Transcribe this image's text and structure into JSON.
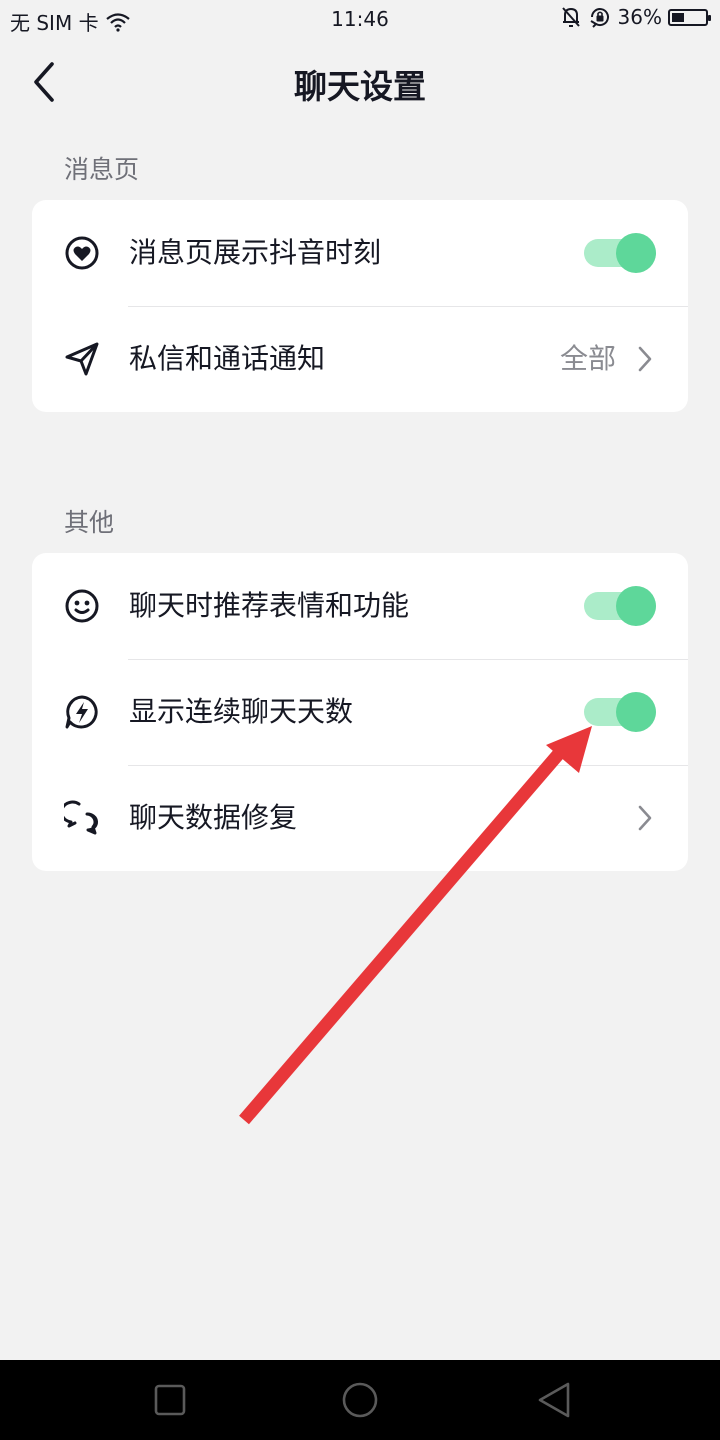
{
  "status_bar": {
    "carrier": "无 SIM 卡",
    "time": "11:46",
    "battery": "36%",
    "battery_level": 0.36,
    "icons": [
      "wifi-icon",
      "bell-off-icon",
      "rotation-lock-icon",
      "battery-icon"
    ]
  },
  "header": {
    "title": "聊天设置",
    "back_icon": "chevron-left-icon"
  },
  "sections": [
    {
      "label": "消息页",
      "items": [
        {
          "icon": "heart-circle-icon",
          "label": "消息页展示抖音时刻",
          "control": "toggle",
          "on": true
        },
        {
          "icon": "send-icon",
          "label": "私信和通话通知",
          "control": "link",
          "value": "全部"
        }
      ]
    },
    {
      "label": "其他",
      "items": [
        {
          "icon": "smiley-icon",
          "label": "聊天时推荐表情和功能",
          "control": "toggle",
          "on": true
        },
        {
          "icon": "lightning-bubble-icon",
          "label": "显示连续聊天天数",
          "control": "toggle",
          "on": true
        },
        {
          "icon": "chat-bubbles-icon",
          "label": "聊天数据修复",
          "control": "link"
        }
      ]
    }
  ],
  "colors": {
    "background": "#f2f2f2",
    "card": "#ffffff",
    "toggle_track": "#abecc9",
    "toggle_knob": "#5ed79a",
    "annotation_arrow": "#e8373a"
  },
  "annotation": {
    "type": "arrow",
    "target": "显示连续聊天天数 toggle"
  },
  "system_nav": [
    "recent-apps-square-icon",
    "home-circle-icon",
    "back-triangle-icon"
  ]
}
